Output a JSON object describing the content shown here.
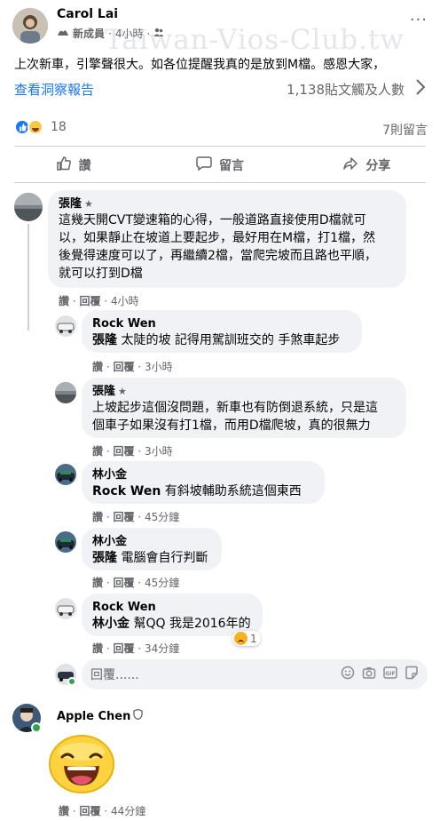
{
  "post": {
    "author": "Carol Lai",
    "badge": "新成員",
    "time": "4小時",
    "more": "···",
    "watermark": "Taiwan-Vios-Club.tw",
    "text": "上次新車，引擎聲很大。如各位提醒我真的是放到M檔。感恩大家，",
    "insights_link": "查看洞察報告",
    "reach": "1,138貼文觸及人數",
    "reaction_count": "18",
    "comment_count": "7則留言"
  },
  "actions": {
    "like": "讚",
    "comment": "留言",
    "share": "分享"
  },
  "comments": [
    {
      "name": "張隆",
      "lines": [
        "這幾天開CVT變速箱的心得，一般道路直接使用D檔就可",
        "以，如果靜止在坡道上要起步，最好用在M檔，打1檔，然",
        "後覺得速度可以了，再繼續2檔，當爬完坡而且路也平順，",
        "就可以打到D檔"
      ],
      "like": "讚",
      "reply": "回覆",
      "time": "4小時"
    }
  ],
  "replies": [
    {
      "name": "Rock Wen",
      "tag": "張隆",
      "text": " 太陡的坡 記得用駕訓班交的 手煞車起步",
      "like": "讚",
      "reply": "回覆",
      "time": "3小時"
    },
    {
      "name": "張隆",
      "lines": [
        "上坡起步這個沒問題，新車也有防倒退系統，只是這",
        "個車子如果沒有打1檔，而用D檔爬坡，真的很無力"
      ],
      "like": "讚",
      "reply": "回覆",
      "time": "3小時"
    },
    {
      "name": "林小金",
      "tag": "Rock Wen",
      "text": " 有斜坡輔助系統這個東西",
      "like": "讚",
      "reply": "回覆",
      "time": "45分鐘"
    },
    {
      "name": "林小金",
      "tag": "張隆",
      "text": " 電腦會自行判斷",
      "like": "讚",
      "reply": "回覆",
      "time": "45分鐘"
    },
    {
      "name": "Rock Wen",
      "tag": "林小金",
      "text": " 幫QQ 我是2016年的",
      "like": "讚",
      "reply": "回覆",
      "time": "34分鐘",
      "reaction_count": "1"
    }
  ],
  "reply_box": {
    "placeholder": "回覆......"
  },
  "last_comment": {
    "name": "Apple Chen",
    "like": "讚",
    "reply": "回覆",
    "time": "44分鐘"
  }
}
